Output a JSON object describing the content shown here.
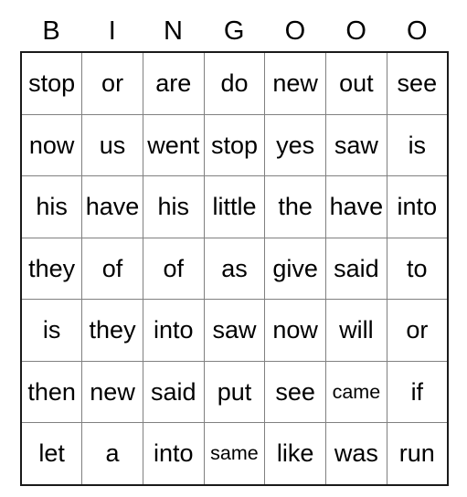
{
  "card": {
    "header_letters": [
      "B",
      "I",
      "N",
      "G",
      "O",
      "O",
      "O"
    ],
    "rows": [
      [
        {
          "text": "stop",
          "small": false
        },
        {
          "text": "or",
          "small": false
        },
        {
          "text": "are",
          "small": false
        },
        {
          "text": "do",
          "small": false
        },
        {
          "text": "new",
          "small": false
        },
        {
          "text": "out",
          "small": false
        },
        {
          "text": "see",
          "small": false
        }
      ],
      [
        {
          "text": "now",
          "small": false
        },
        {
          "text": "us",
          "small": false
        },
        {
          "text": "went",
          "small": false
        },
        {
          "text": "stop",
          "small": false
        },
        {
          "text": "yes",
          "small": false
        },
        {
          "text": "saw",
          "small": false
        },
        {
          "text": "is",
          "small": false
        }
      ],
      [
        {
          "text": "his",
          "small": false
        },
        {
          "text": "have",
          "small": false
        },
        {
          "text": "his",
          "small": false
        },
        {
          "text": "little",
          "small": false
        },
        {
          "text": "the",
          "small": false
        },
        {
          "text": "have",
          "small": false
        },
        {
          "text": "into",
          "small": false
        }
      ],
      [
        {
          "text": "they",
          "small": false
        },
        {
          "text": "of",
          "small": false
        },
        {
          "text": "of",
          "small": false
        },
        {
          "text": "as",
          "small": false
        },
        {
          "text": "give",
          "small": false
        },
        {
          "text": "said",
          "small": false
        },
        {
          "text": "to",
          "small": false
        }
      ],
      [
        {
          "text": "is",
          "small": false
        },
        {
          "text": "they",
          "small": false
        },
        {
          "text": "into",
          "small": false
        },
        {
          "text": "saw",
          "small": false
        },
        {
          "text": "now",
          "small": false
        },
        {
          "text": "will",
          "small": false
        },
        {
          "text": "or",
          "small": false
        }
      ],
      [
        {
          "text": "then",
          "small": false
        },
        {
          "text": "new",
          "small": false
        },
        {
          "text": "said",
          "small": false
        },
        {
          "text": "put",
          "small": false
        },
        {
          "text": "see",
          "small": false
        },
        {
          "text": "came",
          "small": true
        },
        {
          "text": "if",
          "small": false
        }
      ],
      [
        {
          "text": "let",
          "small": false
        },
        {
          "text": "a",
          "small": false
        },
        {
          "text": "into",
          "small": false
        },
        {
          "text": "same",
          "small": true
        },
        {
          "text": "like",
          "small": false
        },
        {
          "text": "was",
          "small": false
        },
        {
          "text": "run",
          "small": false
        }
      ]
    ],
    "colors": {
      "grid_line": "#808080",
      "outer_border": "#1a1a1a",
      "text": "#000000",
      "background": "#ffffff"
    }
  }
}
